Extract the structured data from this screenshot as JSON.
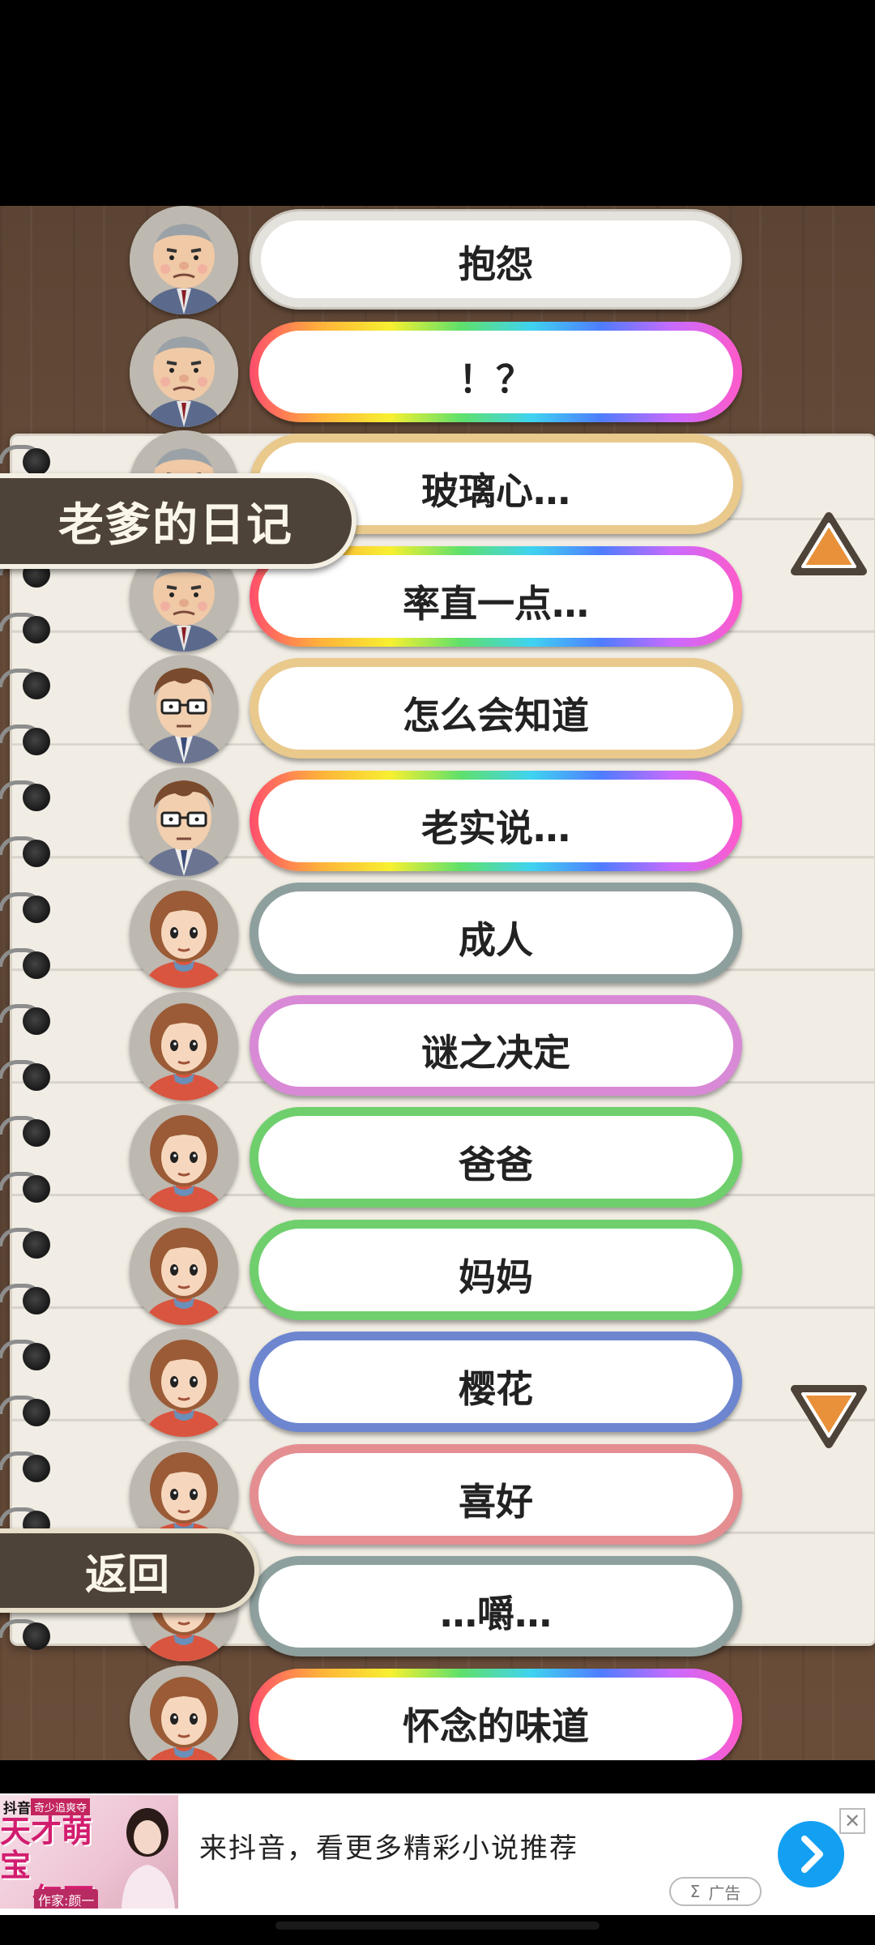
{
  "screen": {
    "title": "老爹的日记",
    "back_label": "返回"
  },
  "entries": [
    {
      "label": "抱怨",
      "character": "grandpa-character",
      "border": "white"
    },
    {
      "label": "！？",
      "character": "grandpa-character",
      "border": "rainbow"
    },
    {
      "label": "玻璃心…",
      "character": "grandpa-character",
      "border": "gold"
    },
    {
      "label": "率直一点…",
      "character": "grandpa-character",
      "border": "rainbow"
    },
    {
      "label": "怎么会知道",
      "character": "dad-character",
      "border": "gold"
    },
    {
      "label": "老实说…",
      "character": "dad-character",
      "border": "rainbow"
    },
    {
      "label": "成人",
      "character": "girl-character",
      "border": "gray"
    },
    {
      "label": "谜之决定",
      "character": "girl-character",
      "border": "pink"
    },
    {
      "label": "爸爸",
      "character": "girl-character",
      "border": "green"
    },
    {
      "label": "妈妈",
      "character": "girl-character",
      "border": "green"
    },
    {
      "label": "樱花",
      "character": "girl-character",
      "border": "blue"
    },
    {
      "label": "喜好",
      "character": "girl-character",
      "border": "rose"
    },
    {
      "label": "…嚼…",
      "character": "girl-character",
      "border": "gray"
    },
    {
      "label": "怀念的味道",
      "character": "girl-character",
      "border": "rainbow"
    }
  ],
  "scroll": {
    "up_icon": "triangle-up-icon",
    "down_icon": "triangle-down-icon",
    "accent_color": "#e8913a"
  },
  "ad": {
    "platform": "抖音",
    "badge": "奇少追爽夺",
    "book_title_line1": "天才萌宝",
    "book_title_line2": "亿万妻",
    "author": "作家:颜一",
    "text": "来抖音，看更多精彩小说推荐",
    "tag": "广告",
    "tag_symbol": "Σ",
    "cta_icon": "chevron-right-icon",
    "close_icon": "close-icon",
    "cta_color": "#13a0f2"
  }
}
